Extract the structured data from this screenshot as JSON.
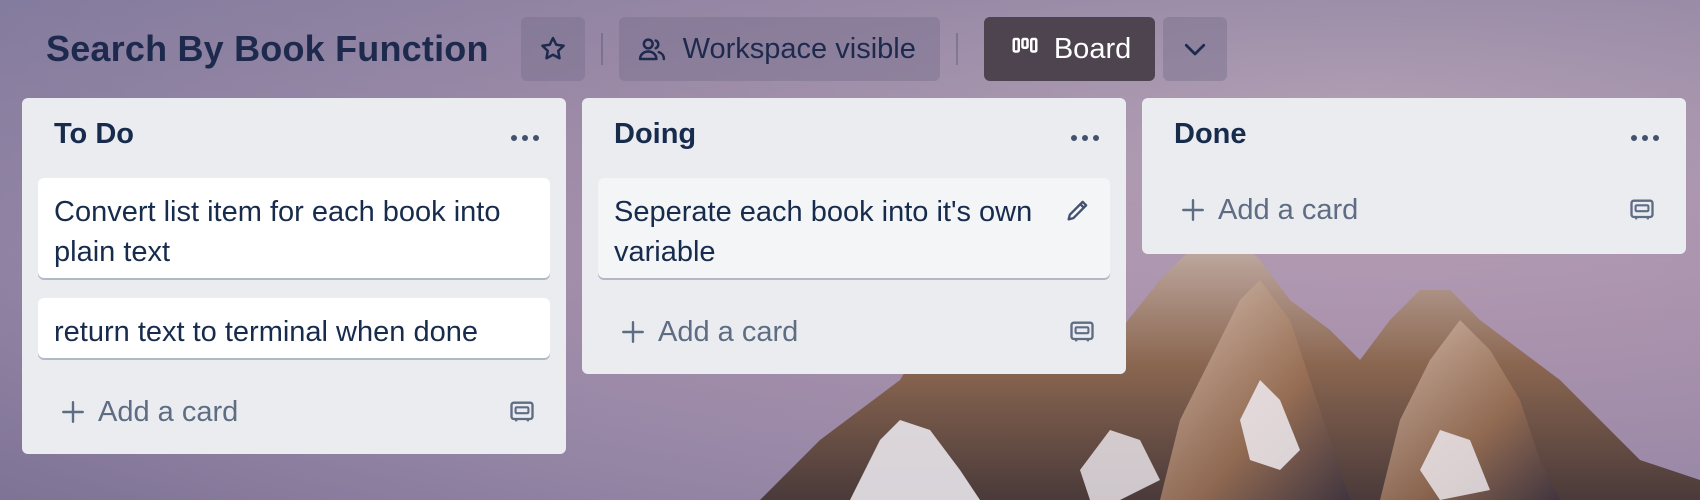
{
  "board": {
    "title": "Search By Book Function",
    "visibility_label": "Workspace visible",
    "view_label": "Board"
  },
  "icons": {
    "star": "star-icon",
    "visibility": "people-icon",
    "board_view": "board-view-icon",
    "expand": "chevron-down-icon",
    "list_menu": "ellipsis-icon",
    "add": "plus-icon",
    "template": "card-template-icon",
    "edit": "pencil-icon"
  },
  "lists": [
    {
      "title": "To Do",
      "cards": [
        "Convert list item for each book into plain text",
        "return text to terminal when done"
      ],
      "add_label": "Add a card"
    },
    {
      "title": "Doing",
      "cards": [
        "Seperate each book into it's own variable"
      ],
      "add_label": "Add a card"
    },
    {
      "title": "Done",
      "cards": [],
      "add_label": "Add a card"
    }
  ],
  "colors": {
    "title_text": "#1e2a4d",
    "list_bg": "#ebecf0",
    "card_bg": "#ffffff",
    "muted_text": "#5e6c84",
    "board_button_bg": "#4d4450"
  }
}
